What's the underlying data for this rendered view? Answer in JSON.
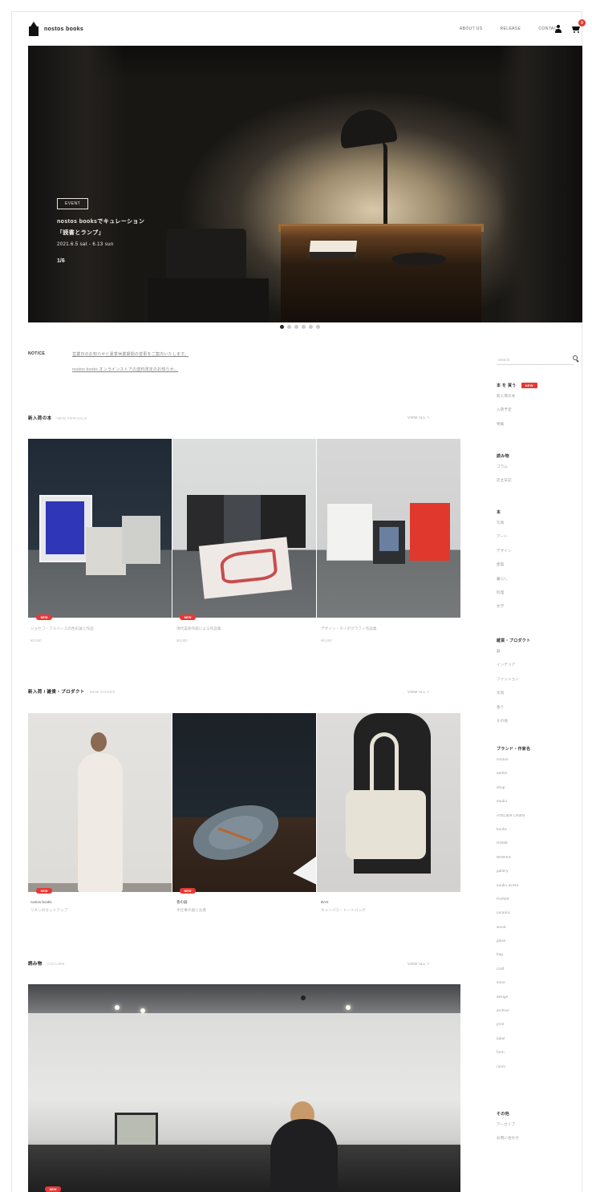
{
  "header": {
    "logo_text": "nostos books",
    "nav": [
      "ABOUT US",
      "RELEASE",
      "CONTACT"
    ],
    "cart_count": "0"
  },
  "hero": {
    "tag": "EVENT",
    "title_line1": "nostos booksでキュレーション",
    "title_line2": "「読書とランプ」",
    "date": "2021.6.5 sat - 6.13 sun",
    "counter": "1/6",
    "dots": 6,
    "active_dot": 0
  },
  "notices": {
    "label": "NOTICE",
    "items": [
      "営業日のお知らせと夏季休業期間の変更をご案内いたします。",
      "nostos books オンラインストアの送料改定のお知らせ。"
    ]
  },
  "search": {
    "placeholder": "Search"
  },
  "sidebar": {
    "groups": [
      {
        "head": "本 を 買う",
        "new_badge": "NEW",
        "items": [
          "新入荷の本",
          "入荷予定",
          "特集"
        ]
      },
      {
        "head": "読み物",
        "items": [
          "コラム",
          "店主日記"
        ]
      },
      {
        "head": "本",
        "items": [
          "写真",
          "アート",
          "デザイン",
          "建築",
          "暮らし",
          "料理",
          "文学"
        ]
      },
      {
        "head": "雑貨・プロダクト",
        "items": [
          "器",
          "インテリア",
          "ファッション",
          "文具",
          "香り",
          "その他"
        ]
      },
      {
        "head": "ブランド・作家名",
        "items": [
          "nostos",
          "atelier",
          "shop",
          "studio",
          "ATELIER LINEN",
          "books",
          "HOME",
          "WORKS",
          "gallery",
          "studio works",
          "PAPER",
          "ceramic",
          "wood",
          "glass",
          "bag",
          "craft",
          "store",
          "design",
          "archive",
          "print",
          "label",
          "form",
          "room"
        ]
      },
      {
        "head": "その他",
        "items": [
          "アーカイブ",
          "お問い合わせ"
        ]
      }
    ]
  },
  "sections": {
    "new_books": {
      "title": "新入荷の本",
      "sub": "NEW ARRIVALS",
      "more": "VIEW ALL >",
      "items": [
        {
          "badge": "NEW",
          "name": "ジョセフ・アルバースの色彩論と作品",
          "price": "¥0,000"
        },
        {
          "badge": "NEW",
          "name": "現代美術作家による作品集",
          "price": "¥0,000"
        },
        {
          "badge": "NEW",
          "name": "デザイン・タイポグラフィ作品集",
          "price": "¥0,000"
        }
      ]
    },
    "goods": {
      "title": "新入荷 / 雑貨・プロダクト",
      "sub": "NEW GOODS",
      "more": "VIEW ALL >",
      "items": [
        {
          "badge": "NEW",
          "brand": "nostos books",
          "name": "リネンのセットアップ"
        },
        {
          "badge": "NEW",
          "brand": "香の器",
          "name": "手仕事の器とお香"
        },
        {
          "badge": "NEW",
          "brand": "BAG",
          "name": "キャンバス・トートバッグ"
        }
      ]
    },
    "column": {
      "title": "読み物",
      "sub": "COLUMN",
      "more": "VIEW ALL >",
      "badge": "NEW"
    }
  }
}
